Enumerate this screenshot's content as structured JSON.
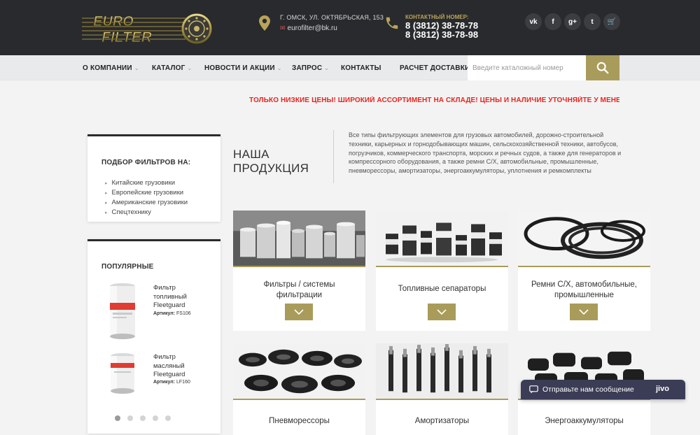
{
  "header": {
    "logo_text_top": "EURO",
    "logo_text_bottom": "FILTER",
    "address": "Г. ОМСК, УЛ. ОКТЯБРЬСКАЯ, 153",
    "email": "eurofilter@bk.ru",
    "contact_label": "КОНТАКТНЫЙ НОМЕР:",
    "phone1": "8 (3812) 38-78-78",
    "phone2": "8 (3812) 38-78-98",
    "social": [
      "vk-icon",
      "facebook-icon",
      "google-plus-icon",
      "twitter-icon",
      "cart-icon"
    ],
    "social_labels": {
      "vk": "vk",
      "facebook": "f",
      "gplus": "g+",
      "twitter": "t",
      "cart": "🛒"
    }
  },
  "nav": {
    "items": [
      {
        "label": "О КОМПАНИИ",
        "has_dropdown": true
      },
      {
        "label": "КАТАЛОГ",
        "has_dropdown": true
      },
      {
        "label": "НОВОСТИ И АКЦИИ",
        "has_dropdown": true
      },
      {
        "label": "ЗАПРОС",
        "has_dropdown": true
      },
      {
        "label": "КОНТАКТЫ",
        "has_dropdown": false
      },
      {
        "label": "РАСЧЕТ ДОСТАВКИ",
        "has_dropdown": false
      }
    ],
    "chevron": "⌄",
    "search_placeholder": "Введите каталожный номер"
  },
  "banner": "ТОЛЬКО НИЗКИЕ ЦЕНЫ! ШИРОКИЙ АССОРТИМЕНТ НА СКЛАДЕ! ЦЕНЫ И НАЛИЧИЕ УТОЧНЯЙТЕ У МЕНЕДЖ",
  "sidebar": {
    "filter_title": "ПОДБОР ФИЛЬТРОВ НА:",
    "filter_items": [
      "Китайские грузовики",
      "Европейские грузовики",
      "Американские грузовики",
      "Спецтехнику"
    ],
    "popular_title": "ПОПУЛЯРНЫЕ",
    "popular": [
      {
        "name_l1": "Фильтр",
        "name_l2": "топливный",
        "name_l3": "Fleetguard",
        "art_label": "Артикул:",
        "art": "FS106"
      },
      {
        "name_l1": "Фильтр",
        "name_l2": "масляный",
        "name_l3": "Fleetguard",
        "art_label": "Артикул:",
        "art": "LF160"
      }
    ],
    "carousel_pages": 5,
    "carousel_active": 1
  },
  "main": {
    "title_l1": "НАША",
    "title_l2": "ПРОДУКЦИЯ",
    "description": "Все типы фильтрующих элементов для грузовых автомобилей, дорожно-строительной техники, карьерных и горнодобывающих машин, сельскохозяйственной техники, автобусов, погрузчиков, коммерческого транспорта, морских и речных судов, а также для генераторов и компрессорного оборудования, а также ремни С/Х, автомобильные, промышленные, пневморессоры, амортизаторы, энергоаккумуляторы, уплотнения и ремкомплекты",
    "products": [
      {
        "l1": "Фильтры / системы",
        "l2": "фильтрации"
      },
      {
        "l1": "Топливные сепараторы",
        "l2": ""
      },
      {
        "l1": "Ремни С/Х, автомобильные,",
        "l2": "промышленные"
      },
      {
        "l1": "Пневморессоры",
        "l2": ""
      },
      {
        "l1": "Амортизаторы",
        "l2": ""
      },
      {
        "l1": "Энергоаккумуляторы",
        "l2": ""
      }
    ]
  },
  "chat": {
    "message": "Отправьте нам сообщение",
    "brand": "jivo"
  },
  "colors": {
    "accent": "#a99c5a",
    "header_bg": "#282a2d",
    "banner_red": "#e8251f",
    "chat_bg": "#3b3c55"
  }
}
